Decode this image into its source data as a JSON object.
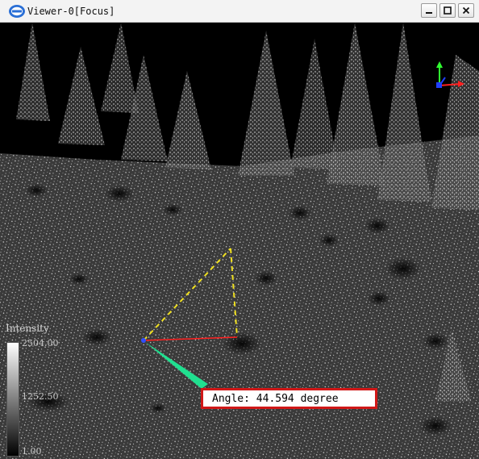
{
  "window": {
    "title": "Viewer-0[Focus]",
    "logo_icon": "lidar-app-logo-icon",
    "buttons": {
      "minimize_icon": "minimize-icon",
      "maximize_icon": "maximize-icon",
      "close_icon": "close-icon"
    }
  },
  "viewport": {
    "background": "#000000",
    "point_color": "#ffffff",
    "axes": {
      "x_color": "#ff2020",
      "y_color": "#30ff30",
      "z_color": "#2040ff"
    }
  },
  "colorbar": {
    "title": "Intensity",
    "max_label": "2504.00",
    "mid_label": "1252.50",
    "min_label": "1.00",
    "gradient": [
      "#ffffff",
      "#000000"
    ]
  },
  "measurement": {
    "angle_label": "Angle: 44.594 degree",
    "angle_value": 44.594,
    "unit": "degree",
    "dashed_color": "#f0e020",
    "red_leg_color": "#ff2020",
    "green_marker_color": "#20e090",
    "box_border_color": "#d01818"
  }
}
